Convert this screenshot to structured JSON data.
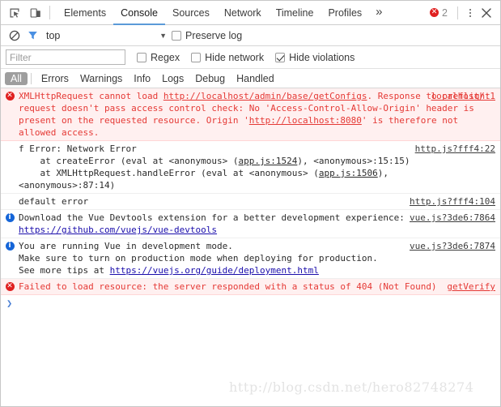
{
  "window": {
    "inspect_icon": "inspect-element-icon",
    "device_icon": "device-toolbar-icon",
    "error_count": "2",
    "menu_icon": "kebab-menu-icon",
    "close_icon": "close-icon"
  },
  "tabs": [
    {
      "label": "Elements",
      "active": false
    },
    {
      "label": "Console",
      "active": true
    },
    {
      "label": "Sources",
      "active": false
    },
    {
      "label": "Network",
      "active": false
    },
    {
      "label": "Timeline",
      "active": false
    },
    {
      "label": "Profiles",
      "active": false
    }
  ],
  "tabs_more": "»",
  "context_bar": {
    "clear_icon": "clear-console-icon",
    "filter_icon": "filter-funnel-icon",
    "context_value": "top",
    "caret": "▼",
    "preserve_log_label": "Preserve log",
    "preserve_log_checked": false
  },
  "filter_bar": {
    "filter_placeholder": "Filter",
    "filter_value": "",
    "options": [
      {
        "label": "Regex",
        "checked": false
      },
      {
        "label": "Hide network",
        "checked": false
      },
      {
        "label": "Hide violations",
        "checked": true
      }
    ]
  },
  "levels": [
    {
      "label": "All",
      "active": true
    },
    {
      "label": "Errors",
      "active": false
    },
    {
      "label": "Warnings",
      "active": false
    },
    {
      "label": "Info",
      "active": false
    },
    {
      "label": "Logs",
      "active": false
    },
    {
      "label": "Debug",
      "active": false
    },
    {
      "label": "Handled",
      "active": false
    }
  ],
  "messages": [
    {
      "level": "error",
      "icon": "error-circle-icon",
      "source": "localhost/:1",
      "text": "XMLHttpRequest cannot load http://localhost/admin/base/getConfigs. Response to preflight request doesn't pass access control check: No 'Access-Control-Allow-Origin' header is present on the requested resource. Origin 'http://localhost:8080' is therefore not allowed access."
    },
    {
      "level": "log",
      "icon": "none",
      "source": "http.js?fff4:22",
      "text": "f Error: Network Error\n    at createError (eval at <anonymous> (app.js:1524), <anonymous>:15:15)\n    at XMLHttpRequest.handleError (eval at <anonymous> (app.js:1506), <anonymous>:87:14)"
    },
    {
      "level": "log",
      "icon": "none",
      "source": "http.js?fff4:104",
      "text": "default error"
    },
    {
      "level": "info",
      "icon": "info-circle-icon",
      "source": "vue.js?3de6:7864",
      "text": "Download the Vue Devtools extension for a better development experience:\nhttps://github.com/vuejs/vue-devtools"
    },
    {
      "level": "info",
      "icon": "info-circle-icon",
      "source": "vue.js?3de6:7874",
      "text": "You are running Vue in development mode.\nMake sure to turn on production mode when deploying for production.\nSee more tips at https://vuejs.org/guide/deployment.html"
    },
    {
      "level": "error",
      "icon": "error-circle-icon",
      "source": "getVerify",
      "text": "Failed to load resource: the server responded with a status of 404 (Not Found)"
    }
  ],
  "prompt": {
    "chevron": "❯"
  },
  "watermark": "http://blog.csdn.net/hero82748274",
  "colors": {
    "error_text": "#e53935",
    "error_bg": "#fff0f0",
    "info_icon": "#1565d8",
    "error_icon": "#e02020",
    "active_tab_underline": "#5b9ad8",
    "prompt_chevron": "#4a7fd4",
    "watermark": "#e3e3e3"
  }
}
